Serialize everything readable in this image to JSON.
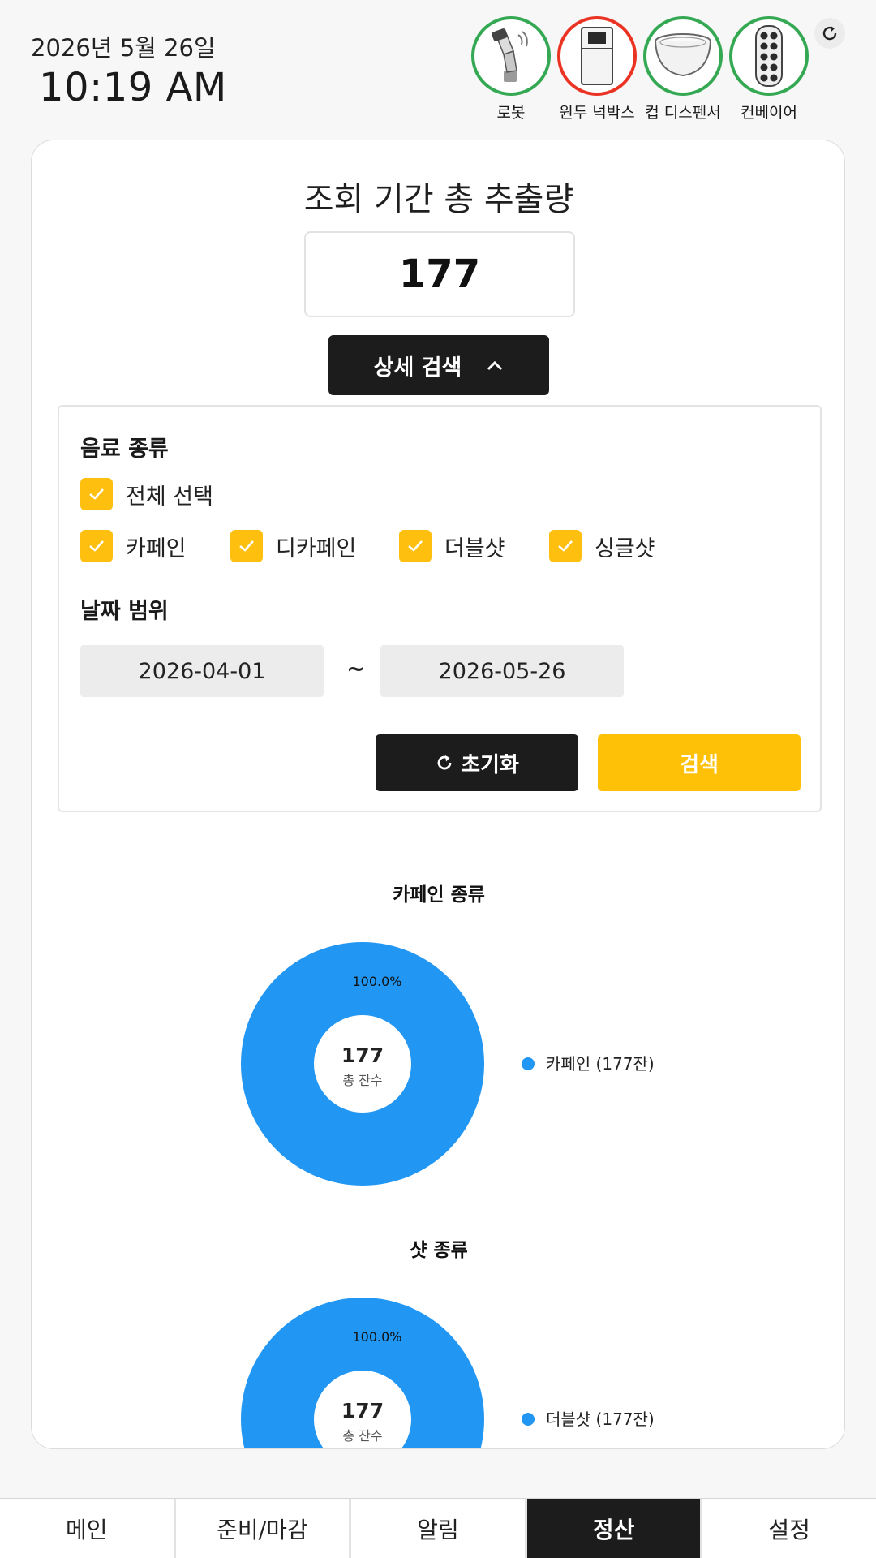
{
  "header": {
    "date": "2026년 5월 26일",
    "time": "10:19 AM",
    "devices": [
      {
        "label": "로봇",
        "icon": "robot-arm-icon",
        "status": "ok"
      },
      {
        "label": "원두 넉박스",
        "icon": "knockbox-icon",
        "status": "error"
      },
      {
        "label": "컵 디스펜서",
        "icon": "cup-dispenser-icon",
        "status": "ok"
      },
      {
        "label": "컨베이어",
        "icon": "conveyor-icon",
        "status": "ok"
      }
    ],
    "refresh_icon": "refresh-icon"
  },
  "summary": {
    "title": "조회 기간 총 추출량",
    "total": "177"
  },
  "detail_search": {
    "label": "상세 검색",
    "icon": "chevron-up-icon"
  },
  "filters": {
    "beverage_label": "음료 종류",
    "select_all": {
      "label": "전체 선택",
      "checked": true
    },
    "options": [
      {
        "label": "카페인",
        "checked": true
      },
      {
        "label": "디카페인",
        "checked": true
      },
      {
        "label": "더블샷",
        "checked": true
      },
      {
        "label": "싱글샷",
        "checked": true
      }
    ],
    "date_label": "날짜 범위",
    "date_from": "2026-04-01",
    "date_sep": "~",
    "date_to": "2026-05-26",
    "reset_label": "초기화",
    "search_label": "검색"
  },
  "chart_data": [
    {
      "type": "pie",
      "title": "카페인 종류",
      "center_value": "177",
      "center_label": "총 잔수",
      "slices": [
        {
          "name": "카페인",
          "value": 177,
          "percent_label": "100.0%",
          "legend": "카페인 (177잔)"
        }
      ],
      "color": "#2196f3"
    },
    {
      "type": "pie",
      "title": "샷 종류",
      "center_value": "177",
      "center_label": "총 잔수",
      "slices": [
        {
          "name": "더블샷",
          "value": 177,
          "percent_label": "100.0%",
          "legend": "더블샷 (177잔)"
        }
      ],
      "color": "#2196f3"
    }
  ],
  "nav": {
    "tabs": [
      {
        "label": "메인",
        "active": false
      },
      {
        "label": "준비/마감",
        "active": false
      },
      {
        "label": "알림",
        "active": false
      },
      {
        "label": "정산",
        "active": true
      },
      {
        "label": "설정",
        "active": false
      }
    ]
  },
  "colors": {
    "accent": "#ffc107",
    "dark": "#1c1c1c",
    "ok": "#34a853",
    "error": "#ea3323",
    "chart": "#2196f3"
  }
}
